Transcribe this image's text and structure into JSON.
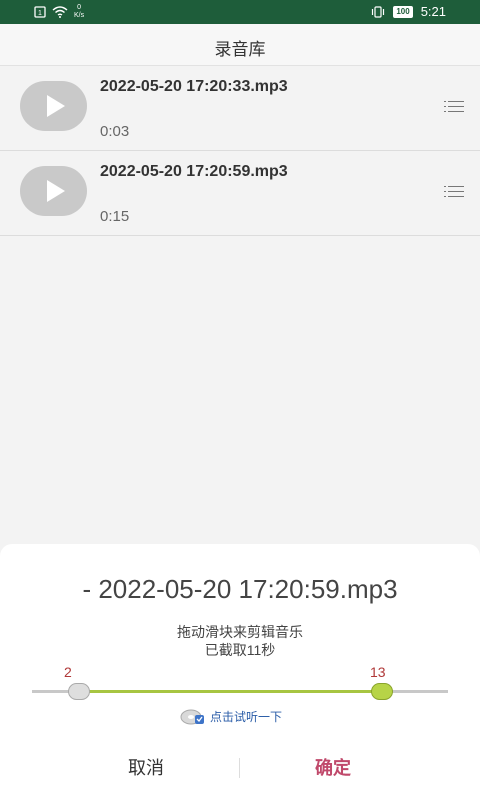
{
  "status_bar": {
    "network_speed_value": "0",
    "network_speed_unit": "K/s",
    "battery": "100",
    "time": "5:21"
  },
  "app_bar": {
    "title": "录音库"
  },
  "recordings": [
    {
      "file_name": "2022-05-20 17:20:33.mp3",
      "duration": "0:03"
    },
    {
      "file_name": "2022-05-20 17:20:59.mp3",
      "duration": "0:15"
    }
  ],
  "trim_sheet": {
    "title": "- 2022-05-20 17:20:59.mp3",
    "hint": "拖动滑块来剪辑音乐",
    "cut_status": "已截取11秒",
    "range_start": "2",
    "range_end": "13",
    "preview_label": "点击试听一下",
    "cancel_label": "取消",
    "confirm_label": "确定"
  },
  "colors": {
    "status_bar": "#1e5d3a",
    "accent_range": "#a7c541",
    "confirm": "#c0496b",
    "range_label": "#b03838"
  }
}
